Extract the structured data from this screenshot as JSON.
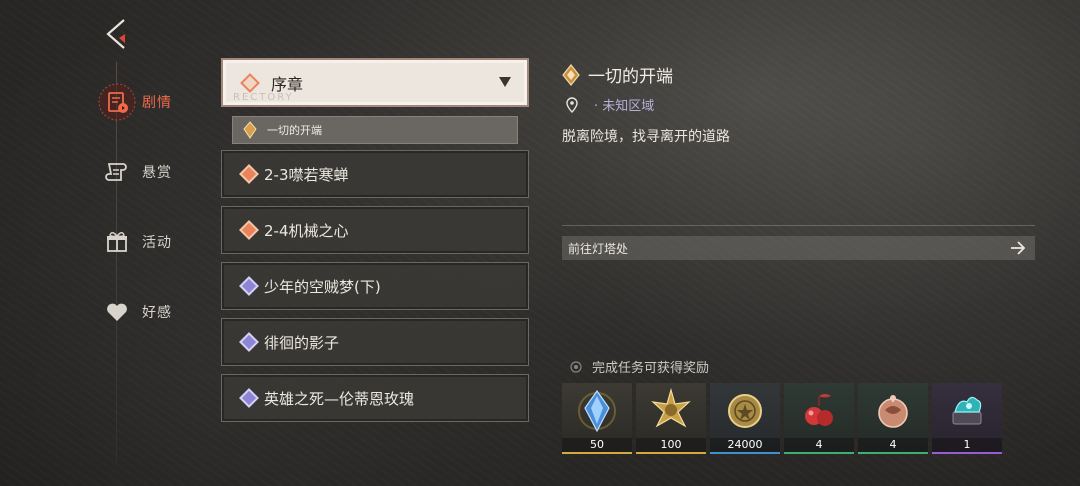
{
  "nav": {
    "items": [
      {
        "label": "剧情",
        "icon": "story-icon",
        "active": true
      },
      {
        "label": "悬赏",
        "icon": "scroll-icon",
        "active": false
      },
      {
        "label": "活动",
        "icon": "gift-icon",
        "active": false
      },
      {
        "label": "好感",
        "icon": "heart-icon",
        "active": false
      }
    ]
  },
  "chapter": {
    "title": "序章",
    "watermark": "RECTORY",
    "selected_sub": "一切的开端"
  },
  "quests": [
    {
      "label": "2-3噤若寒蝉",
      "color": "orange"
    },
    {
      "label": "2-4机械之心",
      "color": "orange"
    },
    {
      "label": "少年的空贼梦(下)",
      "color": "purple"
    },
    {
      "label": "徘徊的影子",
      "color": "purple"
    },
    {
      "label": "英雄之死—伦蒂恩玫瑰",
      "color": "purple"
    }
  ],
  "detail": {
    "title": "一切的开端",
    "location": "· 未知区域",
    "description": "脱离险境，找寻离开的道路",
    "goto_label": "前往灯塔处"
  },
  "rewards": {
    "title": "完成任务可获得奖励",
    "items": [
      {
        "count": "50",
        "icon": "blue-crystal-icon",
        "rarity_color": "#d4a93e"
      },
      {
        "count": "100",
        "icon": "gold-star-icon",
        "rarity_color": "#d4a93e"
      },
      {
        "count": "24000",
        "icon": "gold-coin-icon",
        "rarity_color": "#3f8fd1"
      },
      {
        "count": "4",
        "icon": "red-fruit-icon",
        "rarity_color": "#3fae74"
      },
      {
        "count": "4",
        "icon": "bronze-orb-icon",
        "rarity_color": "#3fae74"
      },
      {
        "count": "1",
        "icon": "teal-gem-icon",
        "rarity_color": "#9b5ad6"
      }
    ]
  },
  "colors": {
    "accent": "#f06a4a",
    "panel": "#3a3835",
    "header_bg": "#ece6df"
  }
}
